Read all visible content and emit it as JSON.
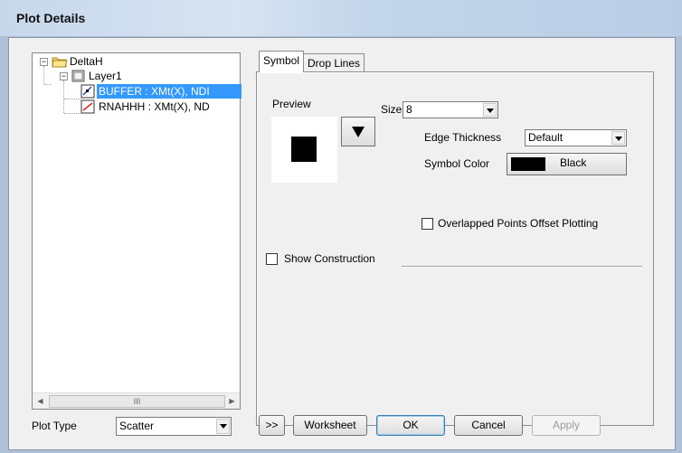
{
  "window": {
    "title": "Plot Details"
  },
  "tree": {
    "root": "DeltaH",
    "layer": "Layer1",
    "items": [
      {
        "label": "BUFFER : XMt(X), NDI",
        "selected": true
      },
      {
        "label": "RNAHHH : XMt(X), ND"
      }
    ],
    "scroll_thumb": "III"
  },
  "tabs": [
    {
      "label": "Symbol",
      "active": true
    },
    {
      "label": "Drop Lines",
      "active": false
    }
  ],
  "symbol": {
    "preview_label": "Preview",
    "size_label": "Size",
    "size_value": "8",
    "edge_thickness_label": "Edge Thickness",
    "edge_thickness_value": "Default",
    "symbol_color_label": "Symbol Color",
    "symbol_color_value": "Black",
    "symbol_color_hex": "#000000",
    "overlapped_label": "Overlapped Points Offset Plotting",
    "overlapped_checked": false,
    "show_construction_label": "Show Construction",
    "show_construction_checked": false
  },
  "bottom": {
    "plot_type_label": "Plot Type",
    "plot_type_value": "Scatter",
    "expand_label": ">>",
    "worksheet_label": "Worksheet",
    "ok_label": "OK",
    "cancel_label": "Cancel",
    "apply_label": "Apply"
  }
}
